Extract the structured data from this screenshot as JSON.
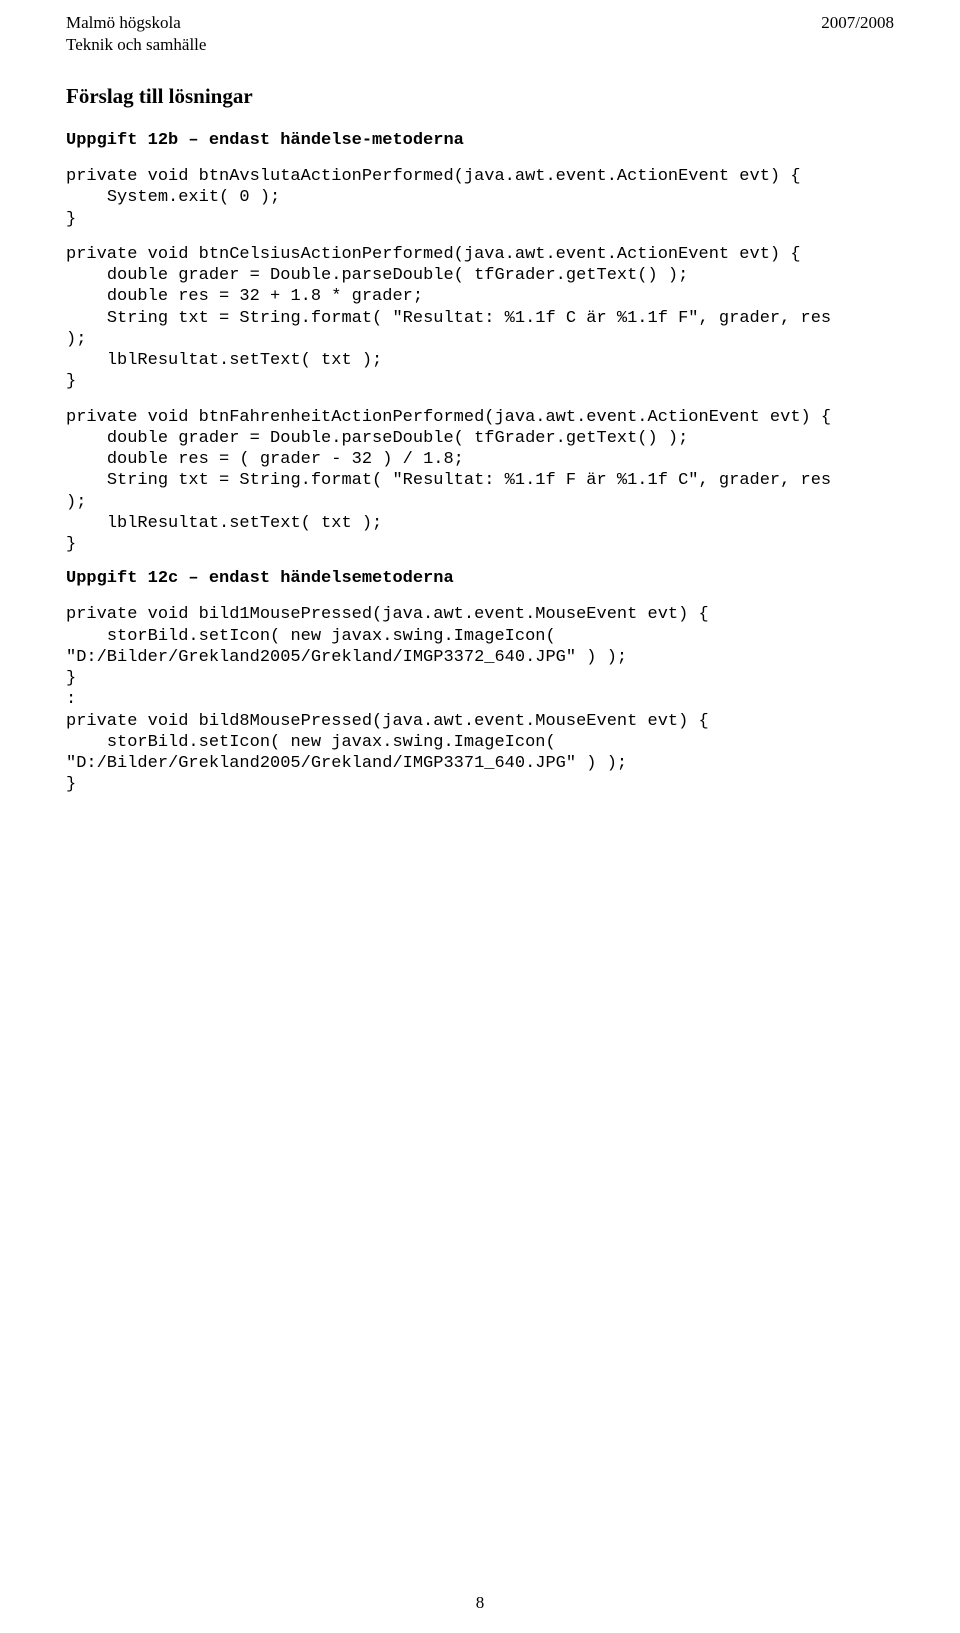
{
  "header": {
    "org1": "Malmö högskola",
    "org2": "Teknik och samhälle",
    "year": "2007/2008"
  },
  "title": "Förslag till lösningar",
  "section12b": "Uppgift 12b – endast händelse-metoderna",
  "code1": "private void btnAvslutaActionPerformed(java.awt.event.ActionEvent evt) {\n    System.exit( 0 );\n}",
  "code2": "private void btnCelsiusActionPerformed(java.awt.event.ActionEvent evt) {\n    double grader = Double.parseDouble( tfGrader.getText() );\n    double res = 32 + 1.8 * grader;\n    String txt = String.format( \"Resultat: %1.1f C är %1.1f F\", grader, res\n);\n    lblResultat.setText( txt );\n}",
  "code3": "private void btnFahrenheitActionPerformed(java.awt.event.ActionEvent evt) {\n    double grader = Double.parseDouble( tfGrader.getText() );\n    double res = ( grader - 32 ) / 1.8;\n    String txt = String.format( \"Resultat: %1.1f F är %1.1f C\", grader, res\n);\n    lblResultat.setText( txt );\n}",
  "section12c": "Uppgift 12c – endast händelsemetoderna",
  "code4": "private void bild1MousePressed(java.awt.event.MouseEvent evt) {\n    storBild.setIcon( new javax.swing.ImageIcon(\n\"D:/Bilder/Grekland2005/Grekland/IMGP3372_640.JPG\" ) );\n}\n:\nprivate void bild8MousePressed(java.awt.event.MouseEvent evt) {\n    storBild.setIcon( new javax.swing.ImageIcon(\n\"D:/Bilder/Grekland2005/Grekland/IMGP3371_640.JPG\" ) );\n}",
  "page_number": "8"
}
